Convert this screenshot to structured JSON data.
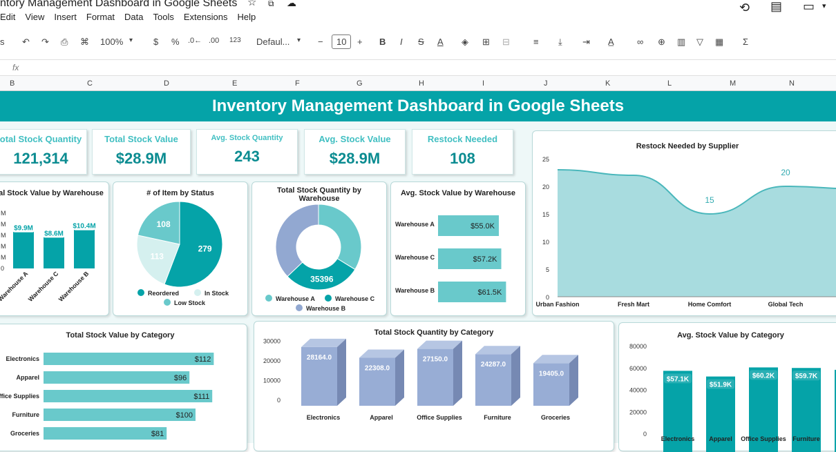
{
  "app": {
    "doc_title": "ntory Management Dashboard in Google Sheets",
    "menu": [
      "Edit",
      "View",
      "Insert",
      "Format",
      "Data",
      "Tools",
      "Extensions",
      "Help"
    ]
  },
  "toolbar": {
    "search_stub": "s",
    "zoom": "100%",
    "currency": "$",
    "percent": "%",
    "dec_less": ".0←",
    "dec_more": ".00",
    "number_format": "123",
    "font": "Defaul...",
    "font_size": "10",
    "minus": "−",
    "plus": "+",
    "bold": "B",
    "italic": "I",
    "strike": "S",
    "text_color": "A",
    "sum": "Σ"
  },
  "formula_bar": {
    "fx": "fx"
  },
  "columns": [
    "B",
    "C",
    "D",
    "E",
    "F",
    "G",
    "H",
    "I",
    "J",
    "K",
    "L",
    "M",
    "N"
  ],
  "banner": {
    "title": "Inventory Management Dashboard in Google Sheets"
  },
  "kpis": [
    {
      "label": "otal Stock Quantity",
      "value": "121,314"
    },
    {
      "label": "Total Stock Value",
      "value": "$28.9M"
    },
    {
      "label": "Avg. Stock Quantity",
      "value": "243"
    },
    {
      "label": "Avg.  Stock Value",
      "value": "$28.9M"
    },
    {
      "label": "Restock Needed",
      "value": "108"
    }
  ],
  "colors": {
    "teal": "#05a3a8",
    "light_teal": "#69c9cb",
    "pale_teal": "#d5f0ef",
    "blue": "#92a8d1",
    "area": "#a8dcdf"
  },
  "chart_data": [
    {
      "type": "bar",
      "title": "al Stock Value by Warehouse",
      "categories": [
        "Warehouse A",
        "Warehouse C",
        "Warehouse B"
      ],
      "values": [
        9.9,
        8.6,
        10.4
      ],
      "data_labels": [
        "$9.9M",
        "$8.6M",
        "$10.4M"
      ],
      "y_tick_labels": [
        "M",
        "M",
        "M",
        "M",
        "M",
        "0"
      ]
    },
    {
      "type": "pie",
      "title": "# of Item by Status",
      "categories": [
        "Reordered",
        "In Stock",
        "Low Stock"
      ],
      "values": [
        279,
        113,
        108
      ],
      "data_labels": [
        "279",
        "113",
        "108"
      ],
      "legend": "bottom"
    },
    {
      "type": "pie",
      "title": "Total Stock Quantity by Warehouse",
      "categories": [
        "Warehouse A",
        "Warehouse C",
        "Warehouse B"
      ],
      "values": [
        41000,
        35396,
        45000
      ],
      "data_labels": [
        "",
        "35396",
        ""
      ],
      "legend": "bottom"
    },
    {
      "type": "bar",
      "title": "Avg.  Stock Value by Warehouse",
      "categories": [
        "Warehouse A",
        "Warehouse C",
        "Warehouse B"
      ],
      "values": [
        55.0,
        57.2,
        61.5
      ],
      "data_labels": [
        "$55.0K",
        "$57.2K",
        "$61.5K"
      ]
    },
    {
      "type": "area",
      "title": "Restock Needed by Supplier",
      "categories": [
        "Urban Fashion",
        "Fresh Mart",
        "Home Comfort",
        "Global Tech",
        ""
      ],
      "values": [
        23,
        22,
        15,
        20,
        19.5
      ],
      "data_labels": [
        "",
        "",
        "15",
        "20",
        ""
      ],
      "ylim": [
        0,
        25
      ],
      "y_ticks": [
        "0",
        "5",
        "10",
        "15",
        "20",
        "25"
      ]
    },
    {
      "type": "bar",
      "title": "Total Stock Value by Category",
      "categories": [
        "Electronics",
        "Apparel",
        "Office Supplies",
        "Furniture",
        "Groceries"
      ],
      "values": [
        112,
        96,
        111,
        100,
        81
      ],
      "data_labels": [
        "$112",
        "$96",
        "$111",
        "$100",
        "$81"
      ]
    },
    {
      "type": "bar",
      "title": "Total Stock Quantity by Category",
      "categories": [
        "Electronics",
        "Apparel",
        "Office Supplies",
        "Furniture",
        "Groceries"
      ],
      "values": [
        28164.0,
        22308.0,
        27150.0,
        24287.0,
        19405.0
      ],
      "data_labels": [
        "28164.0",
        "22308.0",
        "27150.0",
        "24287.0",
        "19405.0"
      ],
      "ylim": [
        0,
        30000
      ],
      "y_ticks": [
        "0",
        "10000",
        "20000",
        "30000"
      ]
    },
    {
      "type": "bar",
      "title": "Avg.  Stock Value by Category",
      "categories": [
        "Electronics",
        "Apparel",
        "Office Supplies",
        "Furniture",
        ""
      ],
      "values": [
        57.1,
        51.9,
        60.2,
        59.7,
        58
      ],
      "data_labels": [
        "$57.1K",
        "$51.9K",
        "$60.2K",
        "$59.7K",
        ""
      ],
      "ylim": [
        0,
        80000
      ],
      "y_ticks": [
        "0",
        "20000",
        "40000",
        "60000",
        "80000"
      ]
    }
  ]
}
